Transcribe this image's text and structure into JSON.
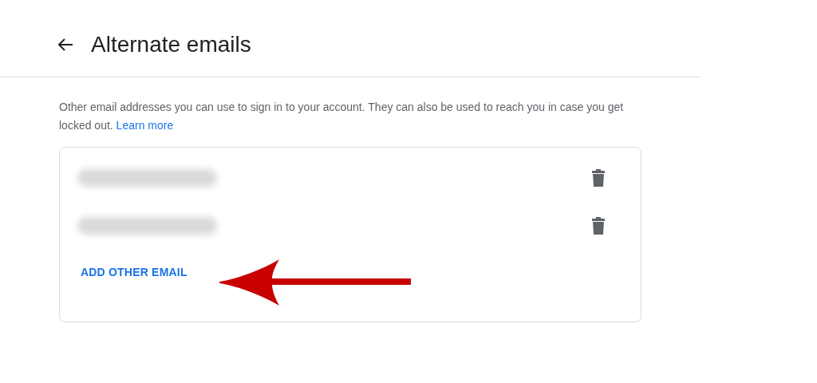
{
  "header": {
    "title": "Alternate emails"
  },
  "description": {
    "text": "Other email addresses you can use to sign in to your account. They can also be used to reach you in case you get locked out.",
    "link": "Learn more"
  },
  "emails": [
    {
      "kind": "blurred"
    },
    {
      "kind": "blurred"
    }
  ],
  "add_button": "ADD OTHER EMAIL"
}
